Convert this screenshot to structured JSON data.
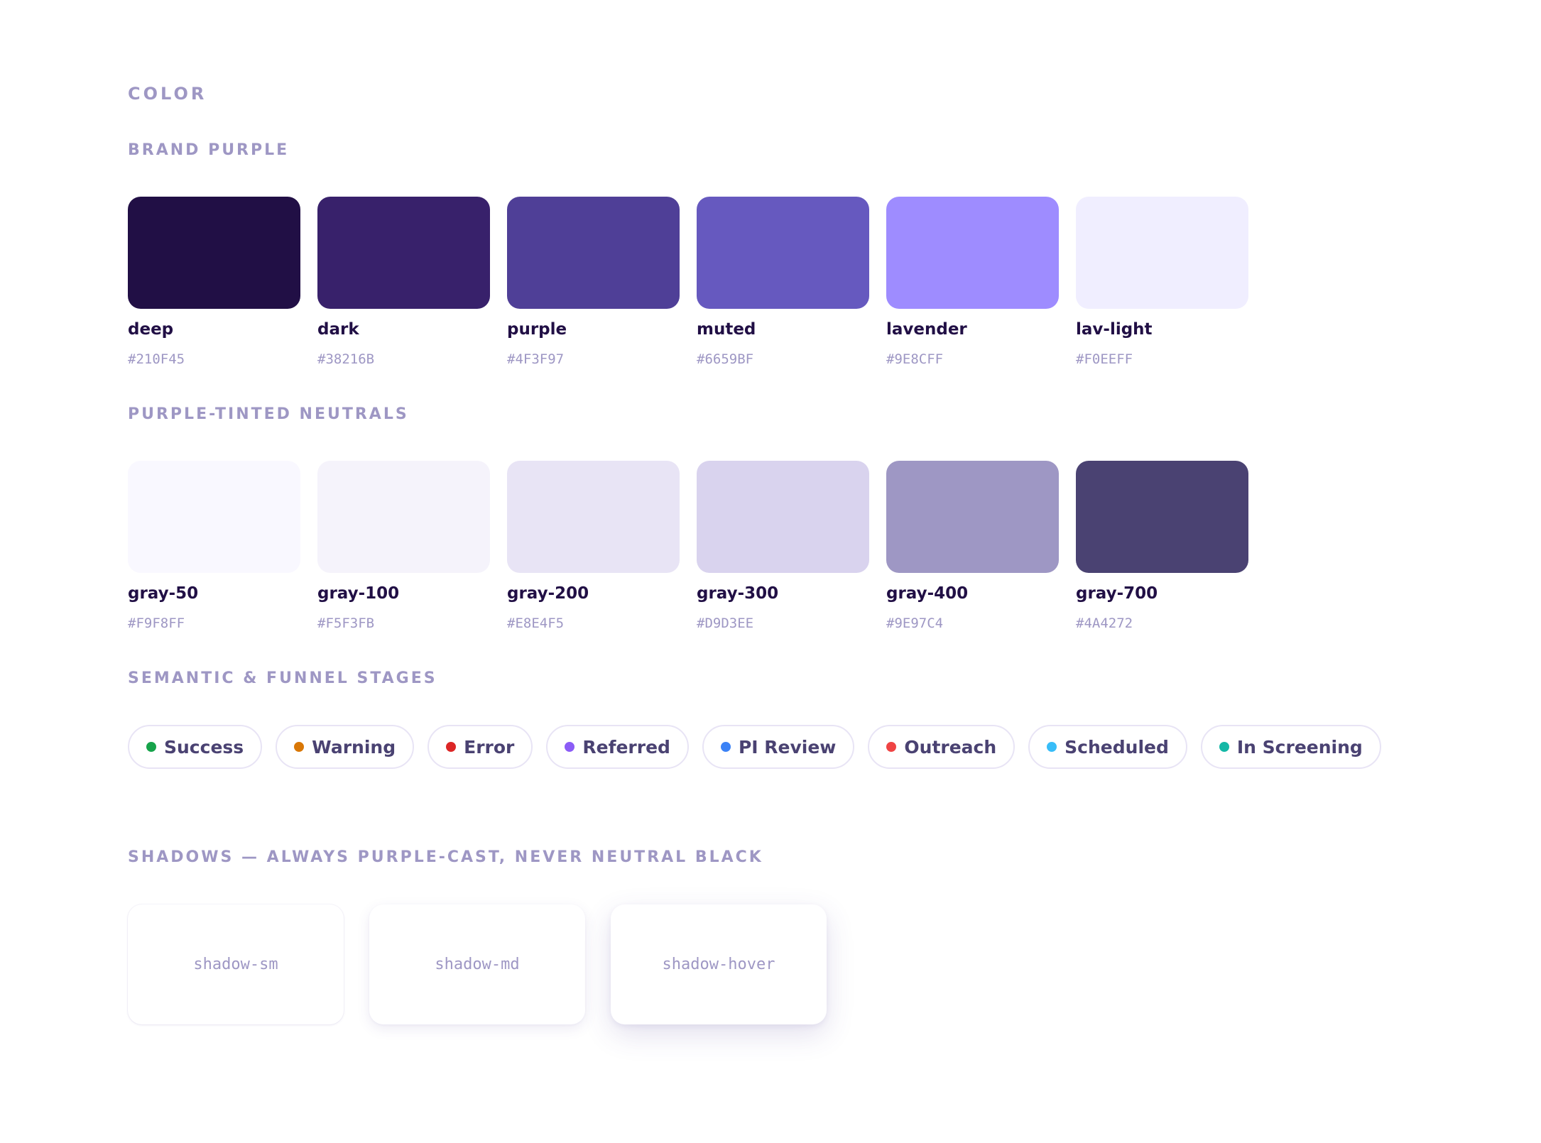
{
  "heading": "COLOR",
  "brand": {
    "title": "BRAND PURPLE",
    "swatches": [
      {
        "name": "deep",
        "hex": "#210F45",
        "color": "#210f45"
      },
      {
        "name": "dark",
        "hex": "#38216B",
        "color": "#38216b"
      },
      {
        "name": "purple",
        "hex": "#4F3F97",
        "color": "#4f3f97"
      },
      {
        "name": "muted",
        "hex": "#6659BF",
        "color": "#6659bf"
      },
      {
        "name": "lavender",
        "hex": "#9E8CFF",
        "color": "#9e8cff"
      },
      {
        "name": "lav-light",
        "hex": "#F0EEFF",
        "color": "#f0eeff"
      }
    ]
  },
  "neutrals": {
    "title": "PURPLE-TINTED NEUTRALS",
    "swatches": [
      {
        "name": "gray-50",
        "hex": "#F9F8FF",
        "color": "#f9f8ff"
      },
      {
        "name": "gray-100",
        "hex": "#F5F3FB",
        "color": "#f5f3fb"
      },
      {
        "name": "gray-200",
        "hex": "#E8E4F5",
        "color": "#e8e4f5"
      },
      {
        "name": "gray-300",
        "hex": "#D9D3EE",
        "color": "#d9d3ee"
      },
      {
        "name": "gray-400",
        "hex": "#9E97C4",
        "color": "#9e97c4"
      },
      {
        "name": "gray-700",
        "hex": "#4A4272",
        "color": "#4a4272"
      }
    ]
  },
  "semantic": {
    "title": "SEMANTIC & FUNNEL STAGES",
    "pills": [
      {
        "label": "Success",
        "dot": "#16a34a"
      },
      {
        "label": "Warning",
        "dot": "#d97706"
      },
      {
        "label": "Error",
        "dot": "#dc2626"
      },
      {
        "label": "Referred",
        "dot": "#8b5cf6"
      },
      {
        "label": "PI Review",
        "dot": "#3b82f6"
      },
      {
        "label": "Outreach",
        "dot": "#ef4444"
      },
      {
        "label": "Scheduled",
        "dot": "#38bdf8"
      },
      {
        "label": "In Screening",
        "dot": "#14b8a6"
      }
    ]
  },
  "shadows": {
    "title": "SHADOWS — ALWAYS PURPLE-CAST, NEVER NEUTRAL BLACK",
    "cards": [
      {
        "label": "shadow-sm"
      },
      {
        "label": "shadow-md"
      },
      {
        "label": "shadow-hover"
      }
    ]
  }
}
